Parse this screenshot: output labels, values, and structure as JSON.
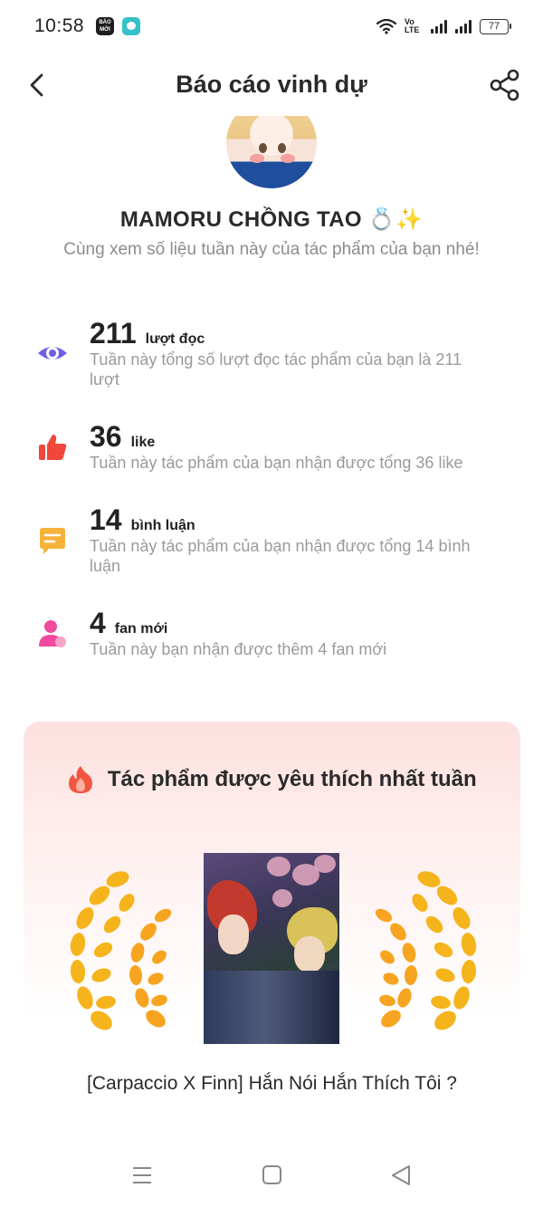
{
  "status_bar": {
    "time": "10:58",
    "app_icons": [
      "baomoi-icon",
      "chat-bubble-icon"
    ],
    "baomoi_label": "BÁO MỚI",
    "volte_label": "Vo LTE",
    "battery_level": "77"
  },
  "header": {
    "title": "Báo cáo vinh dự",
    "back_icon": "chevron-left-icon",
    "share_icon": "share-icon"
  },
  "profile": {
    "username": "MAMORU CHỒNG TAO 💍✨",
    "subtitle": "Cùng xem số liệu tuần này của tác phẩm của bạn nhé!"
  },
  "stats": [
    {
      "icon": "eye-icon",
      "color": "#6e5fe8",
      "number": "211",
      "unit": "lượt đọc",
      "description": "Tuần này tổng số lượt đọc tác phẩm của bạn là 211 lượt"
    },
    {
      "icon": "thumbs-up-icon",
      "color": "#f0463c",
      "number": "36",
      "unit": "like",
      "description": "Tuần này tác phẩm của bạn nhận được tổng 36 like"
    },
    {
      "icon": "comment-icon",
      "color": "#f7b23b",
      "number": "14",
      "unit": "bình luận",
      "description": "Tuần này tác phẩm của bạn nhận được tổng 14 bình luận"
    },
    {
      "icon": "user-icon",
      "color": "#ef4a9e",
      "number": "4",
      "unit": "fan mới",
      "description": "Tuần này bạn nhận được thêm 4 fan mới"
    }
  ],
  "favorite": {
    "icon": "fire-icon",
    "title": "Tác phẩm được yêu thích nhất tuần",
    "work_title": "[Carpaccio X Finn] Hắn Nói Hắn Thích Tôi ?",
    "laurel_color": "#f5b41c"
  },
  "nav_bar": {
    "buttons": [
      "menu-icon",
      "home-square-icon",
      "back-triangle-icon"
    ]
  }
}
